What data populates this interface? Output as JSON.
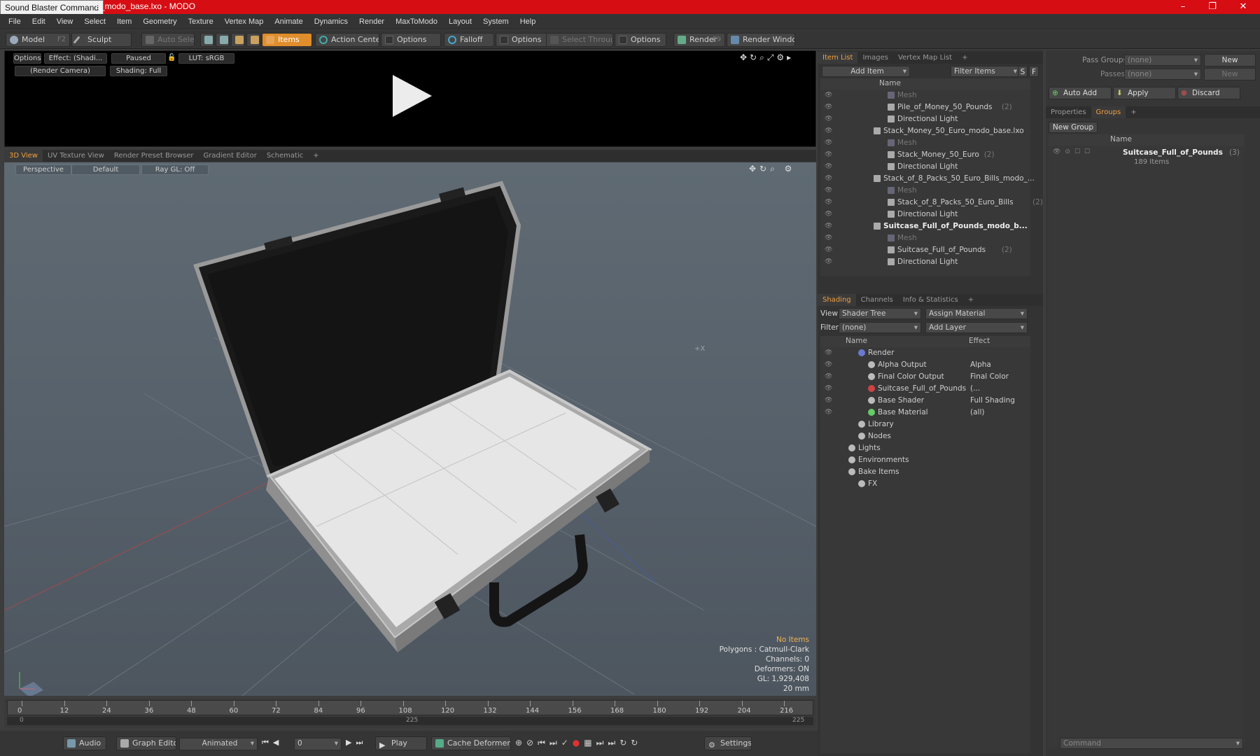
{
  "window": {
    "tooltip": "Sound Blaster Command",
    "title": "s_modo_base.lxo - MODO"
  },
  "menu": [
    "File",
    "Edit",
    "View",
    "Select",
    "Item",
    "Geometry",
    "Texture",
    "Vertex Map",
    "Animate",
    "Dynamics",
    "Render",
    "MaxToModo",
    "Layout",
    "System",
    "Help"
  ],
  "toolbar": {
    "model": "Model",
    "model_key": "F2",
    "sculpt": "Sculpt",
    "auto_select": "Auto Select",
    "items": "Items",
    "action_center": "Action Center",
    "options1": "Options",
    "falloff": "Falloff",
    "options2": "Options",
    "select_through": "Select Through",
    "options3": "Options",
    "render": "Render",
    "render_key": "F9",
    "render_window": "Render Window"
  },
  "render_view": {
    "options": "Options",
    "effect": "Effect: (Shadi...",
    "paused": "Paused",
    "lut": "LUT: sRGB",
    "camera": "(Render Camera)",
    "shading": "Shading: Full"
  },
  "viewport_tabs": [
    "3D View",
    "UV Texture View",
    "Render Preset Browser",
    "Gradient Editor",
    "Schematic",
    "+"
  ],
  "viewport": {
    "perspective": "Perspective",
    "default": "Default",
    "raygl": "Ray GL: Off",
    "axis_label": "+X"
  },
  "stats": {
    "no_items": "No Items",
    "polygons": "Polygons : Catmull-Clark",
    "channels": "Channels: 0",
    "deformers": "Deformers: ON",
    "gl": "GL: 1,929,408",
    "size": "20 mm"
  },
  "timeline": {
    "ticks": [
      "0",
      "12",
      "24",
      "36",
      "48",
      "60",
      "72",
      "84",
      "96",
      "108",
      "120",
      "132",
      "144",
      "156",
      "168",
      "180",
      "192",
      "204",
      "216"
    ],
    "range_start": "0",
    "range_mid": "225",
    "range_end": "225"
  },
  "bottom": {
    "audio": "Audio",
    "graph_editor": "Graph Editor",
    "animated": "Animated",
    "frame": "0",
    "play": "Play",
    "cache": "Cache Deformers",
    "settings": "Settings"
  },
  "item_list": {
    "tabs": [
      "Item List",
      "Images",
      "Vertex Map List",
      "+"
    ],
    "add_item": "Add Item",
    "filter": "Filter Items",
    "name_header": "Name",
    "rows": [
      {
        "label": "Mesh",
        "indent": 3,
        "muted": true
      },
      {
        "label": "Pile_of_Money_50_Pounds",
        "count": "(2)",
        "indent": 3
      },
      {
        "label": "Directional Light",
        "indent": 3
      },
      {
        "label": "Stack_Money_50_Euro_modo_base.lxo",
        "indent": 2
      },
      {
        "label": "Mesh",
        "indent": 3,
        "muted": true
      },
      {
        "label": "Stack_Money_50_Euro",
        "count": "(2)",
        "indent": 3
      },
      {
        "label": "Directional Light",
        "indent": 3
      },
      {
        "label": "Stack_of_8_Packs_50_Euro_Bills_modo_...",
        "indent": 2
      },
      {
        "label": "Mesh",
        "indent": 3,
        "muted": true
      },
      {
        "label": "Stack_of_8_Packs_50_Euro_Bills",
        "count": "(2)",
        "indent": 3
      },
      {
        "label": "Directional Light",
        "indent": 3
      },
      {
        "label": "Suitcase_Full_of_Pounds_modo_b...",
        "indent": 2,
        "bold": true
      },
      {
        "label": "Mesh",
        "indent": 3,
        "muted": true
      },
      {
        "label": "Suitcase_Full_of_Pounds",
        "count": "(2)",
        "indent": 3
      },
      {
        "label": "Directional Light",
        "indent": 3
      }
    ]
  },
  "shading": {
    "tabs": [
      "Shading",
      "Channels",
      "Info & Statistics",
      "+"
    ],
    "view_label": "View",
    "view_value": "Shader Tree",
    "assign": "Assign Material",
    "filter_label": "Filter",
    "filter_value": "(none)",
    "add_layer": "Add Layer",
    "name_header": "Name",
    "effect_header": "Effect",
    "rows": [
      {
        "label": "Render",
        "effect": "",
        "indent": 1
      },
      {
        "label": "Alpha Output",
        "effect": "Alpha",
        "indent": 2
      },
      {
        "label": "Final Color Output",
        "effect": "Final Color",
        "indent": 2
      },
      {
        "label": "Suitcase_Full_of_Pounds",
        "effect": "(...",
        "indent": 2
      },
      {
        "label": "Base Shader",
        "effect": "Full Shading",
        "indent": 2
      },
      {
        "label": "Base Material",
        "effect": "(all)",
        "indent": 2
      },
      {
        "label": "Library",
        "effect": "",
        "indent": 1
      },
      {
        "label": "Nodes",
        "effect": "",
        "indent": 1
      },
      {
        "label": "Lights",
        "effect": "",
        "indent": 0
      },
      {
        "label": "Environments",
        "effect": "",
        "indent": 0
      },
      {
        "label": "Bake Items",
        "effect": "",
        "indent": 0
      },
      {
        "label": "FX",
        "effect": "",
        "indent": 1
      }
    ]
  },
  "groups_panel": {
    "pass_groups": "Pass Groups",
    "pass_value": "(none)",
    "new": "New",
    "passes": "Passes",
    "passes_value": "(none)",
    "new2": "New",
    "auto_add": "Auto Add",
    "apply": "Apply",
    "discard": "Discard",
    "tabs": [
      "Properties",
      "Groups",
      "+"
    ],
    "new_group": "New Group",
    "name_header": "Name",
    "group_name": "Suitcase_Full_of_Pounds",
    "group_count": "(3)",
    "group_items": "189 Items",
    "command": "Command"
  }
}
